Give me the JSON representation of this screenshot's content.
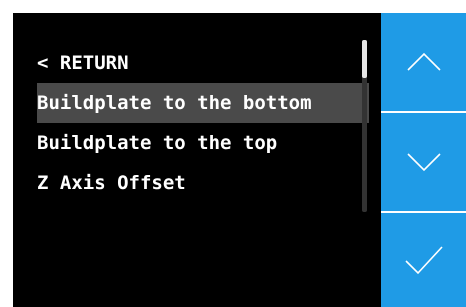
{
  "menu": {
    "items": [
      {
        "label": "< RETURN"
      },
      {
        "label": "Buildplate to the bottom"
      },
      {
        "label": "Buildplate to the top"
      },
      {
        "label": "Z Axis Offset"
      }
    ],
    "selected_index": 1
  },
  "scrollbar": {
    "position_fraction": 0.0,
    "visible_fraction": 0.22
  },
  "buttons": {
    "up_icon": "chevron-up-icon",
    "down_icon": "chevron-down-icon",
    "confirm_icon": "checkmark-icon"
  },
  "colors": {
    "accent": "#1f9be6",
    "screen_background": "#000000",
    "selection": "#4a4a4a",
    "text": "#ffffff"
  }
}
